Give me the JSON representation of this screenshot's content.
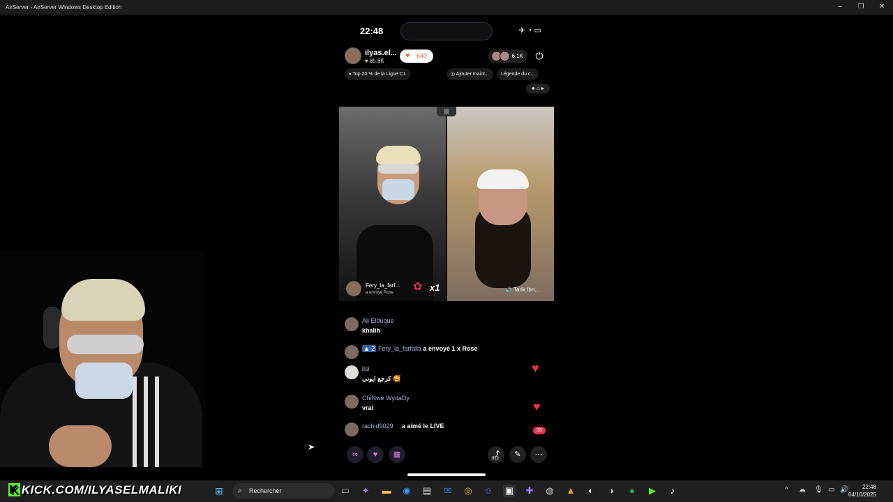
{
  "window": {
    "title": "AirServer - AirServer Windows Desktop Edition"
  },
  "phone": {
    "time": "22:48",
    "host": {
      "name": "ilyas.el...",
      "likes": "85.6K",
      "coins": "640"
    },
    "viewers": "6.1K",
    "pills": [
      "Top 20 % de la Ligue C1",
      "Ajouter maint...",
      "Légende du c..."
    ],
    "gift": {
      "sender": "Fery_la_farf...",
      "subtitle": "a envoyé Rose",
      "multiplier": "x1"
    },
    "guest": "Tarik Ibn..."
  },
  "comments": [
    {
      "name": "Ali Elduque",
      "text": "khalih"
    },
    {
      "name": "Fery_la_farfalla",
      "badge": "2",
      "text": "a envoyé 1 x Rose"
    },
    {
      "name": "lisi",
      "text": "كرجع ايوني 🥰"
    },
    {
      "name": "ChiNwe WydaDy",
      "text": "vrai"
    },
    {
      "name": "rachid9029",
      "text": "a aimé le LIVE"
    }
  ],
  "like_count": "38",
  "share_count": "312",
  "taskbar": {
    "banner": "KICK.COM/ILYASELMALIKI",
    "banner_k": "K",
    "search_placeholder": "Rechercher",
    "time": "22:48",
    "date": "04/10/2025"
  },
  "colors": {
    "accent": "#53fc18",
    "like": "#e8334a",
    "coin": "#f26b3a"
  }
}
